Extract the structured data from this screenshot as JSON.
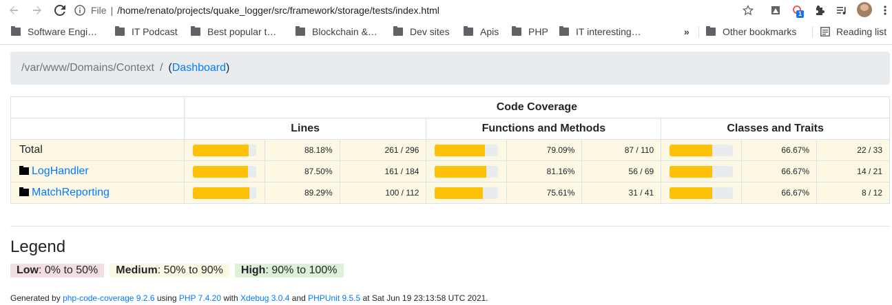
{
  "browser": {
    "file_label": "File",
    "url": "/home/renato/projects/quake_logger/src/framework/storage/tests/index.html",
    "extension_badge": "1",
    "bookmarks": [
      "Software Engi…",
      "IT Podcast",
      "Best popular t…",
      "Blockchain &…",
      "Dev sites",
      "Apis",
      "PHP",
      "IT interesting…"
    ],
    "more_label": "»",
    "other_bookmarks": "Other bookmarks",
    "reading_list": "Reading list"
  },
  "breadcrumb": {
    "path": "/var/www/Domains/Context",
    "slash": "/",
    "open": "(",
    "link": "Dashboard",
    "close": ")"
  },
  "table": {
    "title": "Code Coverage",
    "groups": [
      "Lines",
      "Functions and Methods",
      "Classes and Traits"
    ],
    "rows": [
      {
        "name": "Total",
        "is_dir": false,
        "lines": {
          "pct": "88.18%",
          "num": "261 / 296",
          "fill": 0.8818
        },
        "functions": {
          "pct": "79.09%",
          "num": "87 / 110",
          "fill": 0.7909
        },
        "classes": {
          "pct": "66.67%",
          "num": "22 / 33",
          "fill": 0.6667
        }
      },
      {
        "name": "LogHandler",
        "is_dir": true,
        "lines": {
          "pct": "87.50%",
          "num": "161 / 184",
          "fill": 0.875
        },
        "functions": {
          "pct": "81.16%",
          "num": "56 / 69",
          "fill": 0.8116
        },
        "classes": {
          "pct": "66.67%",
          "num": "14 / 21",
          "fill": 0.6667
        }
      },
      {
        "name": "MatchReporting",
        "is_dir": true,
        "lines": {
          "pct": "89.29%",
          "num": "100 / 112",
          "fill": 0.8929
        },
        "functions": {
          "pct": "75.61%",
          "num": "31 / 41",
          "fill": 0.7561
        },
        "classes": {
          "pct": "66.67%",
          "num": "8 / 12",
          "fill": 0.6667
        }
      }
    ]
  },
  "legend": {
    "title": "Legend",
    "low_label": "Low",
    "low_range": ": 0% to 50%",
    "medium_label": "Medium",
    "medium_range": ": 50% to 90%",
    "high_label": "High",
    "high_range": ": 90% to 100%"
  },
  "footer": {
    "prefix": "Generated by ",
    "tool_link": "php-code-coverage 9.2.6",
    "using": " using ",
    "php_link": "PHP 7.4.20",
    "with": " with ",
    "xdebug_link": "Xdebug 3.0.4",
    "and": " and ",
    "phpunit_link": "PHPUnit 9.5.5",
    "date": " at Sat Jun 19 23:13:58 UTC 2021."
  },
  "colors": {
    "bar_fill": "#ffc107",
    "link": "#007bff",
    "row_bg": "#fcf8e3"
  }
}
